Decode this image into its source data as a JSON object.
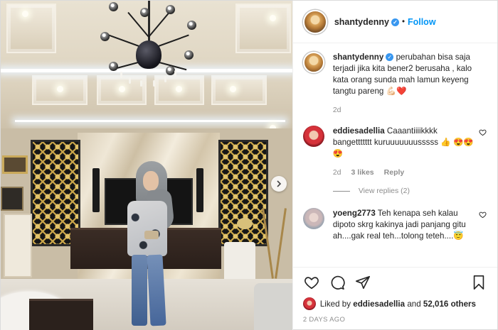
{
  "post": {
    "author": "shantydenny",
    "dot": "•",
    "follow_label": "Follow",
    "caption": "perubahan bisa saja terjadi jika kita bener2 berusaha , kalo kata orang sunda mah lamun keyeng tangtu pareng 💪🏻❤️",
    "caption_age": "2d",
    "likes_prefix": "Liked by",
    "likes_user": "eddiesadellia",
    "likes_and": "and",
    "likes_count": "52,016 others",
    "posted_ago": "2 DAYS AGO",
    "verified_color": "#3897f0",
    "follow_color": "#0095f6"
  },
  "comments": [
    {
      "user": "eddiesadellia",
      "text": "Caaantiiiikkkk bangettttttt kuruuuuuuusssss 👍 😍😍😍",
      "age": "2d",
      "likes": "3 likes",
      "reply": "Reply",
      "view_replies": "View replies (2)"
    },
    {
      "user": "yoeng2773",
      "text": "Teh kenapa seh kalau dipoto skrg kakinya jadi panjang gitu ah....gak real teh...tolong teteh....😇"
    }
  ],
  "icons": {
    "like": "heart-outline-icon",
    "comment": "comment-bubble-icon",
    "share": "paper-plane-icon",
    "save": "bookmark-icon",
    "next": "chevron-right-icon",
    "comment_like": "heart-small-icon"
  }
}
